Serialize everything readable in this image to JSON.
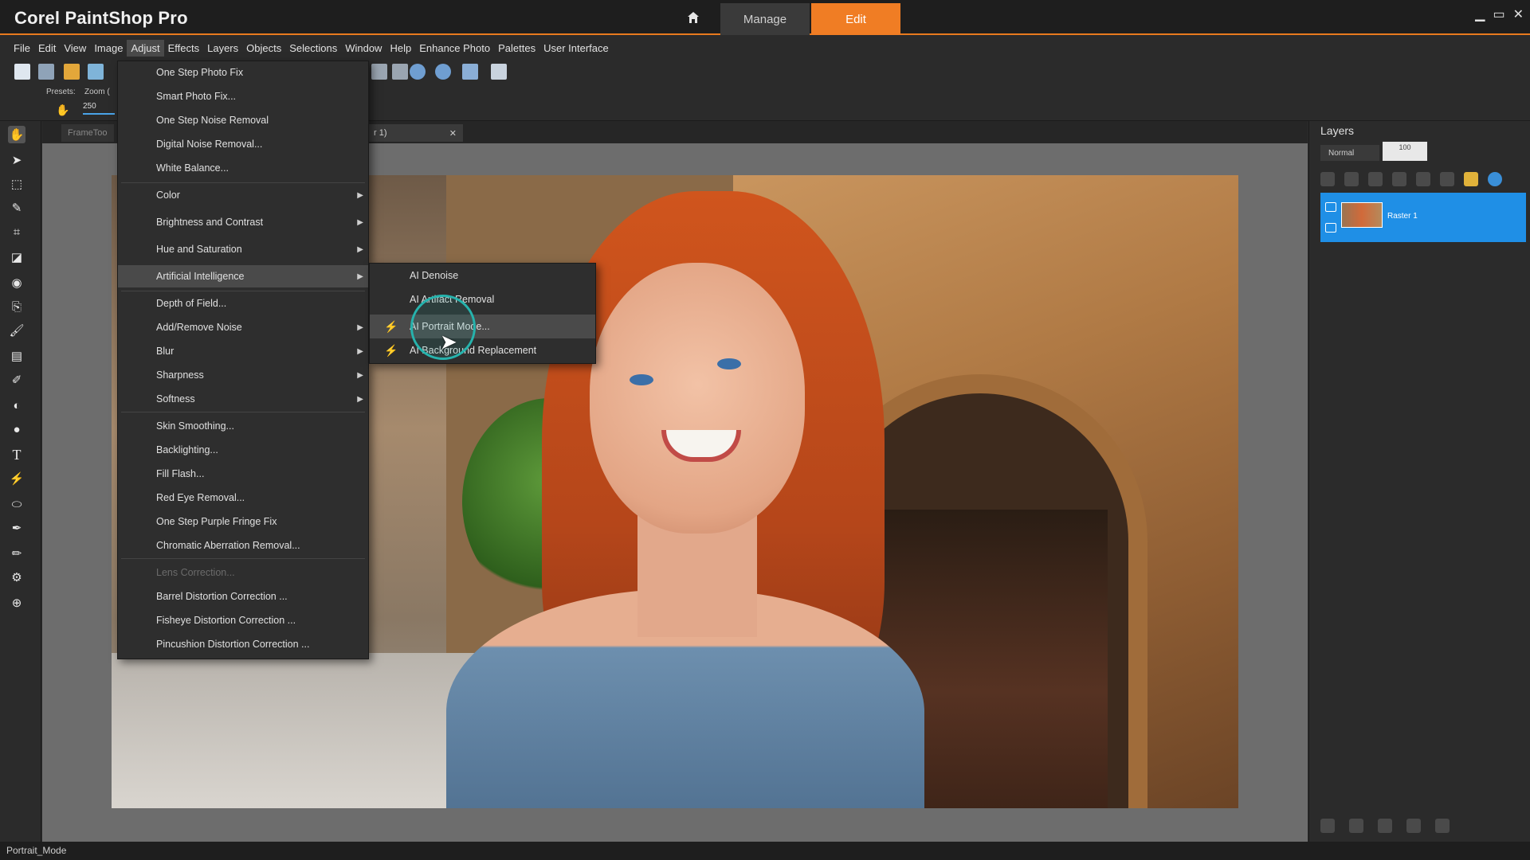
{
  "app": {
    "title": "Corel PaintShop Pro",
    "mode_tabs": [
      "Manage",
      "Edit"
    ],
    "active_mode": "Edit",
    "accent_color": "#f07d24"
  },
  "menubar": {
    "items": [
      "File",
      "Edit",
      "View",
      "Image",
      "Adjust",
      "Effects",
      "Layers",
      "Objects",
      "Selections",
      "Window",
      "Help",
      "Enhance Photo",
      "Palettes",
      "User Interface"
    ],
    "active": "Adjust"
  },
  "options": {
    "presets_label": "Presets:",
    "zoom_label": "Zoom (",
    "zoom_value": "250"
  },
  "doc_tabs": {
    "first": "FrameToo",
    "second": "r 1)"
  },
  "adjust_menu": {
    "items": [
      {
        "label": "One Step Photo Fix",
        "submenu": false
      },
      {
        "label": "Smart Photo Fix...",
        "submenu": false
      },
      {
        "label": "One Step Noise Removal",
        "submenu": false
      },
      {
        "label": "Digital Noise Removal...",
        "submenu": false
      },
      {
        "label": "White Balance...",
        "submenu": false
      },
      {
        "label": "Color",
        "submenu": true
      },
      {
        "label": "Brightness and Contrast",
        "submenu": true
      },
      {
        "label": "Hue and Saturation",
        "submenu": true
      },
      {
        "label": "Artificial Intelligence",
        "submenu": true
      },
      {
        "label": "Depth of Field...",
        "submenu": false
      },
      {
        "label": "Add/Remove Noise",
        "submenu": true
      },
      {
        "label": "Blur",
        "submenu": true
      },
      {
        "label": "Sharpness",
        "submenu": true
      },
      {
        "label": "Softness",
        "submenu": true
      },
      {
        "label": "Skin Smoothing...",
        "submenu": false
      },
      {
        "label": "Backlighting...",
        "submenu": false
      },
      {
        "label": "Fill Flash...",
        "submenu": false
      },
      {
        "label": "Red Eye Removal...",
        "submenu": false
      },
      {
        "label": "One Step Purple Fringe Fix",
        "submenu": false
      },
      {
        "label": "Chromatic Aberration Removal...",
        "submenu": false
      },
      {
        "label": "Lens Correction...",
        "submenu": false
      },
      {
        "label": "Barrel Distortion Correction ...",
        "submenu": false
      },
      {
        "label": "Fisheye Distortion Correction ...",
        "submenu": false
      },
      {
        "label": "Pincushion Distortion Correction ...",
        "submenu": false
      }
    ]
  },
  "ai_submenu": {
    "items": [
      "AI Denoise",
      "AI Artifact Removal",
      "AI Portrait Mode...",
      "AI Background Replacement"
    ]
  },
  "layers": {
    "title": "Layers",
    "blend_mode": "Normal",
    "opacity": "100",
    "layer_name": "Raster 1"
  },
  "status": {
    "text": "Portrait_Mode"
  }
}
